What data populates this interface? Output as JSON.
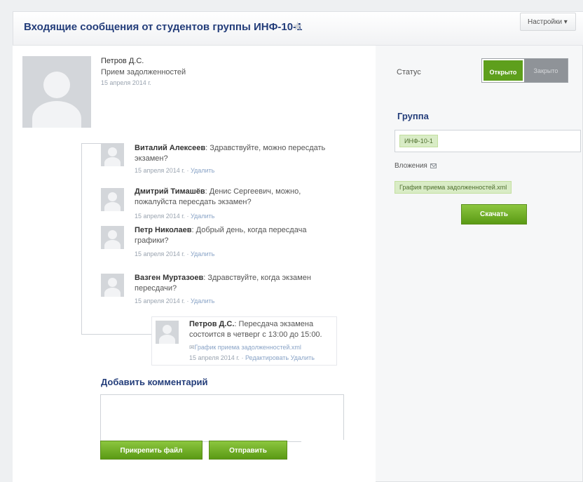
{
  "header": {
    "title": "Входящие сообщения от студентов группы ИНФ-10-1",
    "settings_label": "Настройки ▾"
  },
  "post": {
    "author": "Петров Д.С.",
    "subject": "Прием задолженностей",
    "date": "15 апреля 2014 г."
  },
  "comments": [
    {
      "author": "Виталий Алексеев",
      "text": ": Здравствуйте, можно пересдать экзамен?",
      "date": "15 апреля 2014 г.",
      "delete": "Удалить"
    },
    {
      "author": "Дмитрий Тимашёв",
      "text": ": Денис Сергеевич, можно, пожалуйста пересдать экзамен?",
      "date": "15 апреля 2014 г.",
      "delete": "Удалить"
    },
    {
      "author": "Петр Николаев",
      "text": ": Добрый день, когда пересдача графики?",
      "date": "15 апреля 2014 г.",
      "delete": "Удалить"
    },
    {
      "author": "Вазген Муртазоев",
      "text": ": Здравствуйте, когда экзамен пересдачи?",
      "date": "15 апреля 2014 г.",
      "delete": "Удалить"
    }
  ],
  "reply": {
    "author": "Петров Д.С.",
    "text": ": Пересдача экзамена состоится в четверг с 13:00 до 15:00.",
    "attachment": "График приема задолженностей.xml",
    "date": "15 апреля 2014 г.",
    "edit": "Редактировать",
    "delete": "Удалить"
  },
  "comment_form": {
    "title": "Добавить комментарий",
    "attach_label": "Прикрепить файл",
    "send_label": "Отправить"
  },
  "sidebar": {
    "status_label": "Статус",
    "status_open": "Открыто",
    "status_closed": "Закрыто",
    "group_title": "Группа",
    "group_value": "ИНФ-10-1",
    "attachments_label": "Вложения",
    "attachment_file": "Графия приема задолженностей.xml",
    "download_label": "Скачать"
  },
  "colors": {
    "title": "#233d7a",
    "accent_green": "#5e9f1c",
    "chip_bg": "#d9ecc6"
  }
}
